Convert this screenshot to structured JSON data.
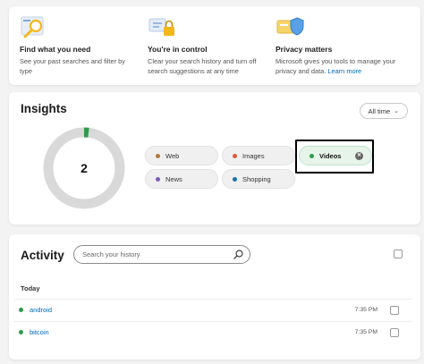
{
  "features": [
    {
      "icon": "search-filter-icon",
      "title": "Find what you need",
      "desc": "See your past searches and filter by type",
      "link": ""
    },
    {
      "icon": "control-lock-icon",
      "title": "You're in control",
      "desc": "Clear your search history and turn off search suggestions at any time",
      "link": ""
    },
    {
      "icon": "privacy-shield-icon",
      "title": "Privacy matters",
      "desc": "Microsoft gives you tools to manage your privacy and data.",
      "link": "Learn more"
    }
  ],
  "insights": {
    "title": "Insights",
    "time_filter": "All time",
    "count": "2",
    "donut_fraction": 0.02,
    "chips": [
      {
        "label": "Web",
        "color": "#b07a3a",
        "selected": false
      },
      {
        "label": "Images",
        "color": "#e05a3a",
        "selected": false
      },
      {
        "label": "Videos",
        "color": "#2e9b4b",
        "selected": true
      },
      {
        "label": "News",
        "color": "#7b5fb5",
        "selected": false
      },
      {
        "label": "Shopping",
        "color": "#1a73a8",
        "selected": false
      }
    ]
  },
  "activity": {
    "title": "Activity",
    "search_placeholder": "Search your history",
    "group_label": "Today",
    "rows": [
      {
        "query": "android",
        "time": "7:35 PM"
      },
      {
        "query": "bitcoin",
        "time": "7:35 PM"
      }
    ]
  },
  "colors": {
    "accent": "#0067b8",
    "videos": "#2e9b4b",
    "donut_track": "#d9d9d9"
  }
}
